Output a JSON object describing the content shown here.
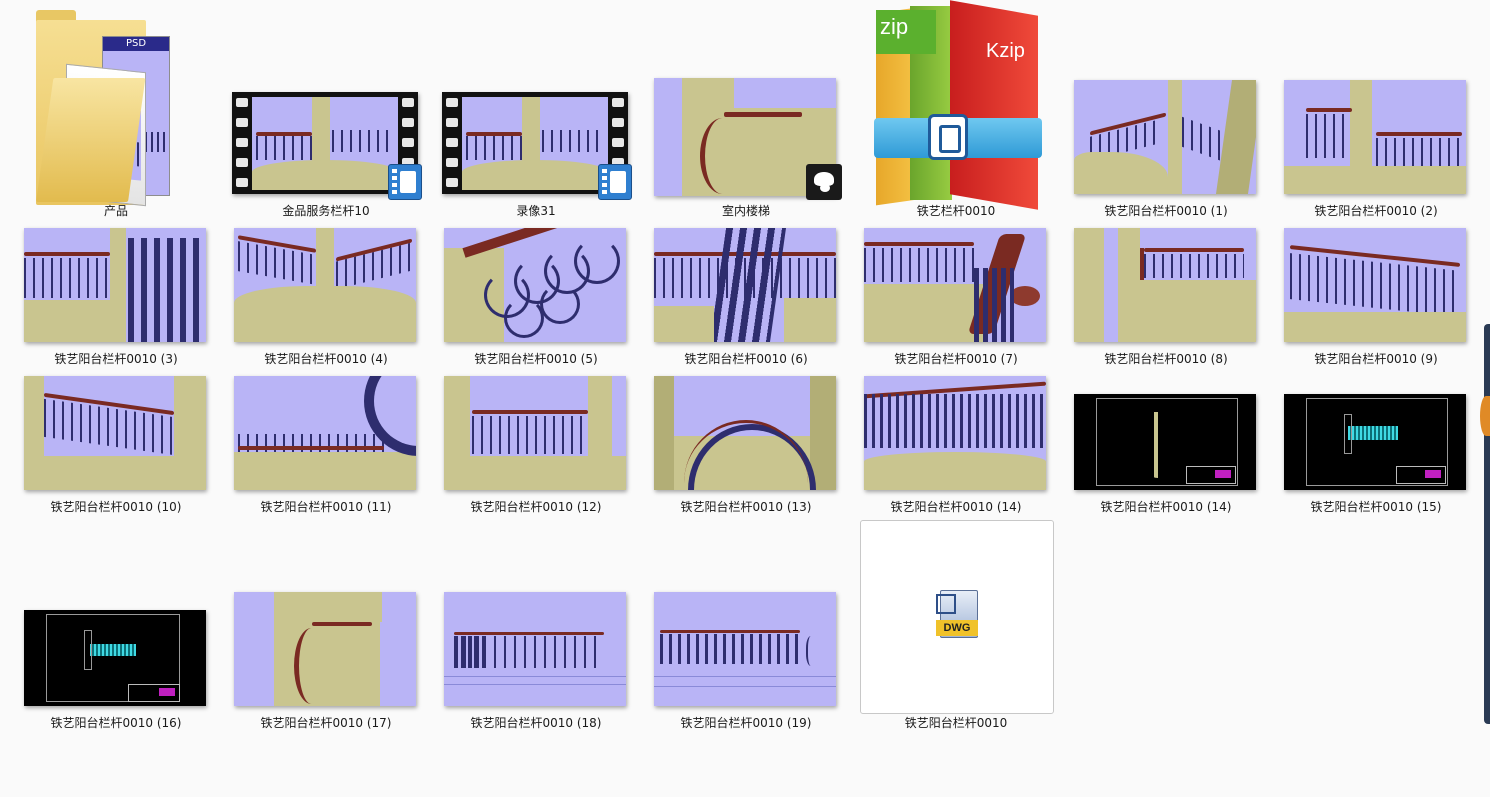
{
  "files": [
    {
      "label": "产品",
      "icon": "folder-icon"
    },
    {
      "label": "金品服务栏杆10",
      "icon": "video-icon"
    },
    {
      "label": "录像31",
      "icon": "video-icon"
    },
    {
      "label": "室内楼梯",
      "icon": "image-icon"
    },
    {
      "label": "铁艺栏杆0010",
      "icon": "zip-archive-icon",
      "icon_text_left": "zip",
      "icon_text_right": "Kzip"
    },
    {
      "label": "铁艺阳台栏杆0010 (1)"
    },
    {
      "label": "铁艺阳台栏杆0010 (2)"
    },
    {
      "label": "铁艺阳台栏杆0010 (3)"
    },
    {
      "label": "铁艺阳台栏杆0010 (4)"
    },
    {
      "label": "铁艺阳台栏杆0010 (5)"
    },
    {
      "label": "铁艺阳台栏杆0010 (6)"
    },
    {
      "label": "铁艺阳台栏杆0010 (7)"
    },
    {
      "label": "铁艺阳台栏杆0010 (8)"
    },
    {
      "label": "铁艺阳台栏杆0010 (9)"
    },
    {
      "label": "铁艺阳台栏杆0010 (10)"
    },
    {
      "label": "铁艺阳台栏杆0010 (11)"
    },
    {
      "label": "铁艺阳台栏杆0010 (12)"
    },
    {
      "label": "铁艺阳台栏杆0010 (13)"
    },
    {
      "label": "铁艺阳台栏杆0010 (14)"
    },
    {
      "label": "铁艺阳台栏杆0010 (14)"
    },
    {
      "label": "铁艺阳台栏杆0010 (15)"
    },
    {
      "label": "铁艺阳台栏杆0010 (16)"
    },
    {
      "label": "铁艺阳台栏杆0010 (17)"
    },
    {
      "label": "铁艺阳台栏杆0010 (18)"
    },
    {
      "label": "铁艺阳台栏杆0010 (19)"
    },
    {
      "label": "铁艺阳台栏杆0010",
      "icon": "dwg-file-icon",
      "icon_text": "DWG"
    }
  ],
  "folder_badge": "PSD",
  "colors": {
    "scene_bg": "#b9b4f6",
    "wall": "#c9c58f",
    "handrail": "#7a2a22",
    "iron": "#2e2d6e",
    "selection_border": "#c8c8c8"
  }
}
